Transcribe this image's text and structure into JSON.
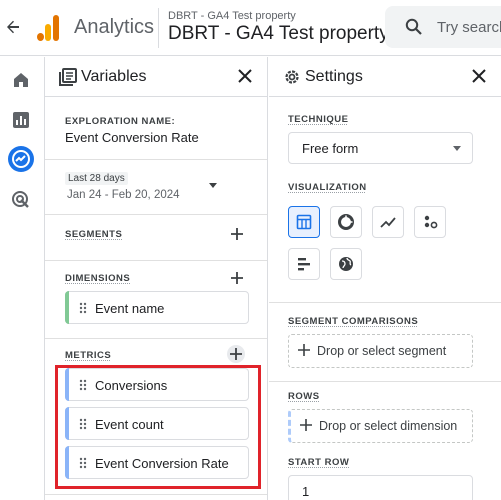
{
  "header": {
    "app_name": "Analytics",
    "account": "DBRT - GA4 Test property",
    "property": "DBRT - GA4 Test property",
    "search_placeholder": "Try search"
  },
  "rail": {
    "items": [
      {
        "icon": "home-icon"
      },
      {
        "icon": "reports-icon"
      },
      {
        "icon": "explore-icon",
        "active": true
      },
      {
        "icon": "advertising-icon"
      }
    ]
  },
  "variables": {
    "title": "Variables",
    "exploration_label": "EXPLORATION NAME:",
    "exploration_name": "Event Conversion Rate",
    "date_chip": "Last 28 days",
    "date_range": "Jan 24 - Feb 20, 2024",
    "segments_label": "SEGMENTS",
    "dimensions_label": "DIMENSIONS",
    "dimensions": [
      "Event name"
    ],
    "metrics_label": "METRICS",
    "metrics": [
      "Conversions",
      "Event count",
      "Event Conversion Rate"
    ]
  },
  "settings": {
    "title": "Settings",
    "technique_label": "TECHNIQUE",
    "technique_value": "Free form",
    "visualization_label": "VISUALIZATION",
    "visualizations": [
      "table-icon",
      "donut-chart-icon",
      "line-chart-icon",
      "scatter-plot-icon",
      "bar-chart-icon",
      "geo-map-icon"
    ],
    "segment_comparisons_label": "SEGMENT COMPARISONS",
    "segment_drop": "Drop or select segment",
    "rows_label": "ROWS",
    "rows_drop": "Drop or select dimension",
    "start_row_label": "START ROW",
    "start_row_value": "1"
  },
  "colors": {
    "accent": "#1a73e8",
    "dimension_bar": "#81c995",
    "metric_bar": "#8ab4f8",
    "highlight": "#e0232a"
  }
}
